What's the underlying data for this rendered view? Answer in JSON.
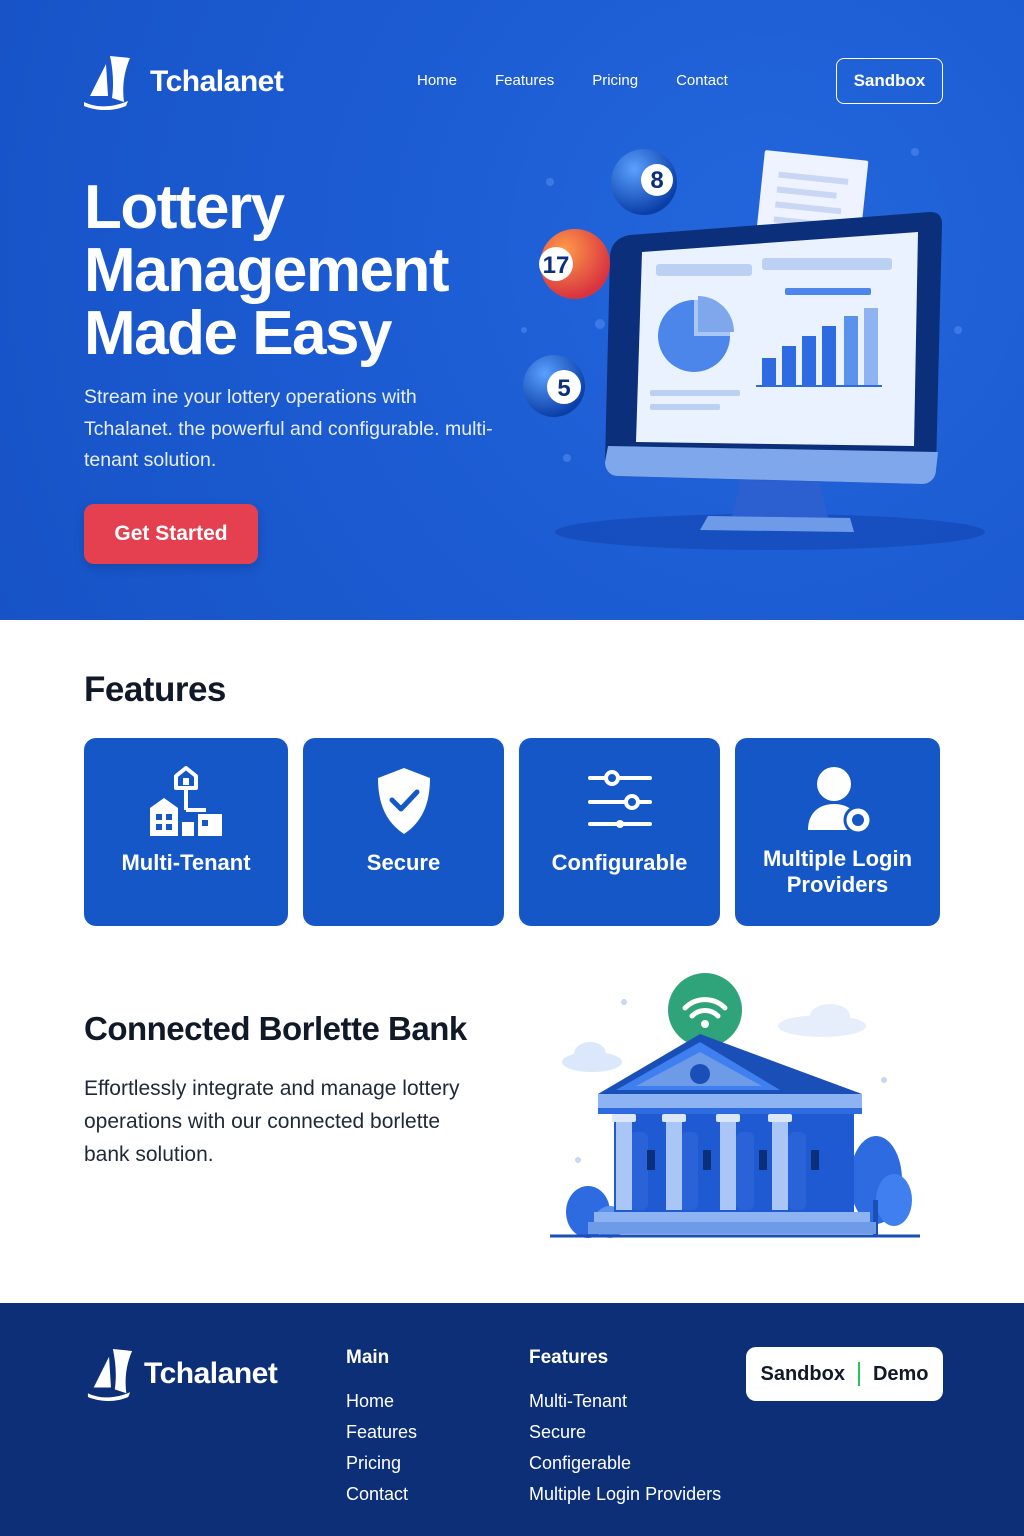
{
  "brand": {
    "name": "Tchalanet"
  },
  "nav": {
    "links": [
      "Home",
      "Features",
      "Pricing",
      "Contact"
    ],
    "sandbox_label": "Sandbox"
  },
  "hero": {
    "title_lines": [
      "Lottery",
      "Management",
      "Made Easy"
    ],
    "subtitle": "Stream ine your lottery operations with Tchalanet. the powerful and configurable. multi-tenant solution.",
    "cta_label": "Get Started",
    "balls": [
      "8",
      "17",
      "5"
    ]
  },
  "features": {
    "title": "Features",
    "cards": [
      {
        "label": "Multi-Tenant",
        "icon": "building-icon"
      },
      {
        "label": "Secure",
        "icon": "shield-check-icon"
      },
      {
        "label": "Configurable",
        "icon": "sliders-icon"
      },
      {
        "label": "Multiple Login Providers",
        "icon": "user-badge-icon"
      }
    ]
  },
  "bank": {
    "title": "Connected Borlette Bank",
    "text": "Effortlessly integrate and manage lottery operations with our connected borlette bank solution."
  },
  "footer": {
    "brand": "Tchalanet",
    "main": {
      "heading": "Main",
      "links": [
        "Home",
        "Features",
        "Pricing",
        "Contact"
      ]
    },
    "features": {
      "heading": "Features",
      "links": [
        "Multi-Tenant",
        "Secure",
        "Configerable",
        "Multiple Login Providers"
      ]
    },
    "buttons": {
      "sandbox": "Sandbox",
      "demo": "Demo"
    }
  },
  "colors": {
    "hero_bg": "#1b5ad0",
    "card_bg": "#1557c7",
    "cta": "#e5404f",
    "footer_bg": "#0d2f78",
    "accent_green": "#22c55e"
  }
}
